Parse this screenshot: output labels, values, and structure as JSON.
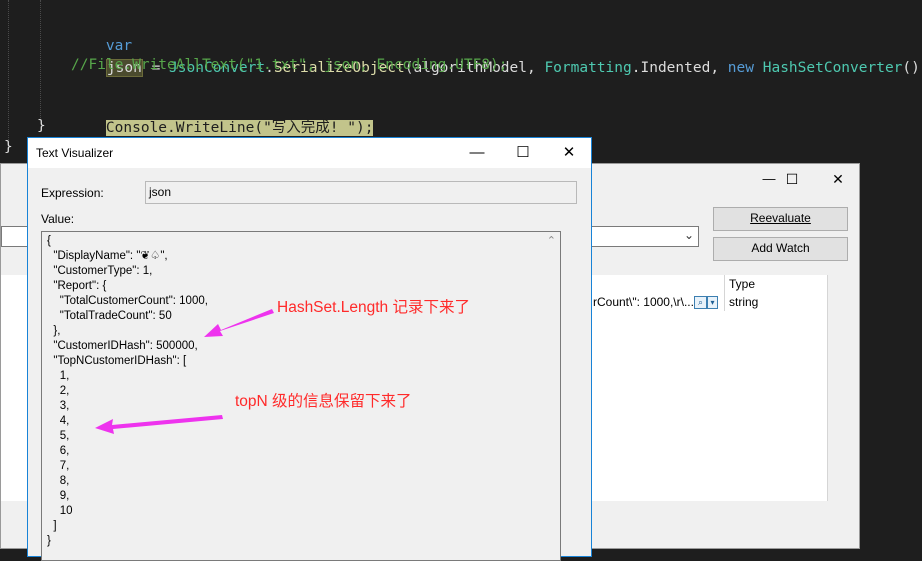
{
  "editor": {
    "line1": {
      "kw_var": "var",
      "json": "json",
      "eq": " = ",
      "type1": "JsonConvert",
      "dot": ".",
      "method": "SerializeObject",
      "args": "(algorithModel, ",
      "type2": "Formatting",
      "indented": ".Indented, ",
      "kw_new": "new",
      "type3": "HashSetConverter",
      "tail": "());"
    },
    "line2": {
      "comment": "//File.WriteAllText(\"1.txt\", json, Encoding.UTF8);"
    },
    "line3": {
      "type": "Console",
      "dot": ".",
      "method": "WriteLine",
      "open": "(",
      "str": "\"写入完成! \"",
      "close": ");"
    },
    "brace_inner": "}",
    "brace_outer": "}"
  },
  "watch": {
    "reevaluate_label": "Reevaluate",
    "add_watch_label": "Add Watch",
    "type_header": "Type",
    "value_snippet": "rCount\\\": 1000,\\r\\...",
    "type_value": "string",
    "minimize_glyph": "—",
    "maximize_glyph": "☐",
    "close_glyph": "✕"
  },
  "visualizer": {
    "title": "Text Visualizer",
    "minimize_glyph": "—",
    "maximize_glyph": "☐",
    "close_glyph": "✕",
    "expression_label": "Expression:",
    "expression_value": "json",
    "value_label": "Value:",
    "json_lines": [
      "{",
      "  \"DisplayName\": \"❦♤\",",
      "  \"CustomerType\": 1,",
      "  \"Report\": {",
      "    \"TotalCustomerCount\": 1000,",
      "    \"TotalTradeCount\": 50",
      "  },",
      "  \"CustomerIDHash\": 500000,",
      "  \"TopNCustomerIDHash\": [",
      "    1,",
      "    2,",
      "    3,",
      "    4,",
      "    5,",
      "    6,",
      "    7,",
      "    8,",
      "    9,",
      "    10",
      "  ]",
      "}"
    ]
  },
  "annotations": {
    "hashset": "HashSet.Length 记录下来了",
    "topn": "topN 级的信息保留下来了",
    "color": "#ff2a2a",
    "arrow_color": "#ee33ee"
  }
}
